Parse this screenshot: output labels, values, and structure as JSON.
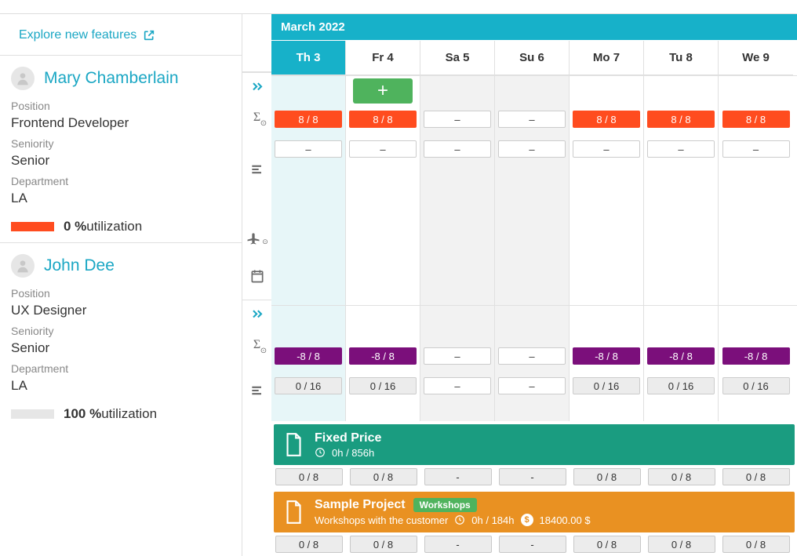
{
  "explore_label": "Explore new features",
  "month_label": "March 2022",
  "days": [
    {
      "label": "Th 3",
      "selected": true,
      "weekend": false
    },
    {
      "label": "Fr 4",
      "selected": false,
      "weekend": false
    },
    {
      "label": "Sa 5",
      "selected": false,
      "weekend": true
    },
    {
      "label": "Su 6",
      "selected": false,
      "weekend": true
    },
    {
      "label": "Mo 7",
      "selected": false,
      "weekend": false
    },
    {
      "label": "Tu 8",
      "selected": false,
      "weekend": false
    },
    {
      "label": "We 9",
      "selected": false,
      "weekend": false
    }
  ],
  "people": [
    {
      "name": "Mary Chamberlain",
      "position_label": "Position",
      "position": "Frontend Developer",
      "seniority_label": "Seniority",
      "seniority": "Senior",
      "department_label": "Department",
      "department": "LA",
      "utilization_pct": "0 %",
      "utilization_word": "utilization",
      "util_color": "#ff4c1f",
      "row1": [
        "8 / 8",
        "8 / 8",
        "–",
        "–",
        "8 / 8",
        "8 / 8",
        "8 / 8"
      ],
      "row1_style": [
        "red",
        "red",
        "white",
        "white",
        "red",
        "red",
        "red"
      ],
      "row2": [
        "–",
        "–",
        "–",
        "–",
        "–",
        "–",
        "–"
      ]
    },
    {
      "name": "John Dee",
      "position_label": "Position",
      "position": "UX Designer",
      "seniority_label": "Seniority",
      "seniority": "Senior",
      "department_label": "Department",
      "department": "LA",
      "utilization_pct": "100 %",
      "utilization_word": "utilization",
      "util_color": "#e6e6e6",
      "row1": [
        "-8 / 8",
        "-8 / 8",
        "–",
        "–",
        "-8 / 8",
        "-8 / 8",
        "-8 / 8"
      ],
      "row1_style": [
        "purple",
        "purple",
        "white",
        "white",
        "purple",
        "purple",
        "purple"
      ],
      "row2": [
        "0 / 16",
        "0 / 16",
        "–",
        "–",
        "0 / 16",
        "0 / 16",
        "0 / 16"
      ]
    }
  ],
  "projects": [
    {
      "color": "green",
      "title": "Fixed Price",
      "subtitle": "",
      "hours": "0h / 856h",
      "budget": "",
      "tag": "",
      "cells": [
        "0 / 8",
        "0 / 8",
        "-",
        "-",
        "0 / 8",
        "0 / 8",
        "0 / 8"
      ]
    },
    {
      "color": "orange",
      "title": "Sample Project",
      "subtitle": "Workshops with the customer",
      "hours": "0h / 184h",
      "budget": "18400.00 $",
      "tag": "Workshops",
      "cells": [
        "0 / 8",
        "0 / 8",
        "-",
        "-",
        "0 / 8",
        "0 / 8",
        "0 / 8"
      ]
    }
  ]
}
